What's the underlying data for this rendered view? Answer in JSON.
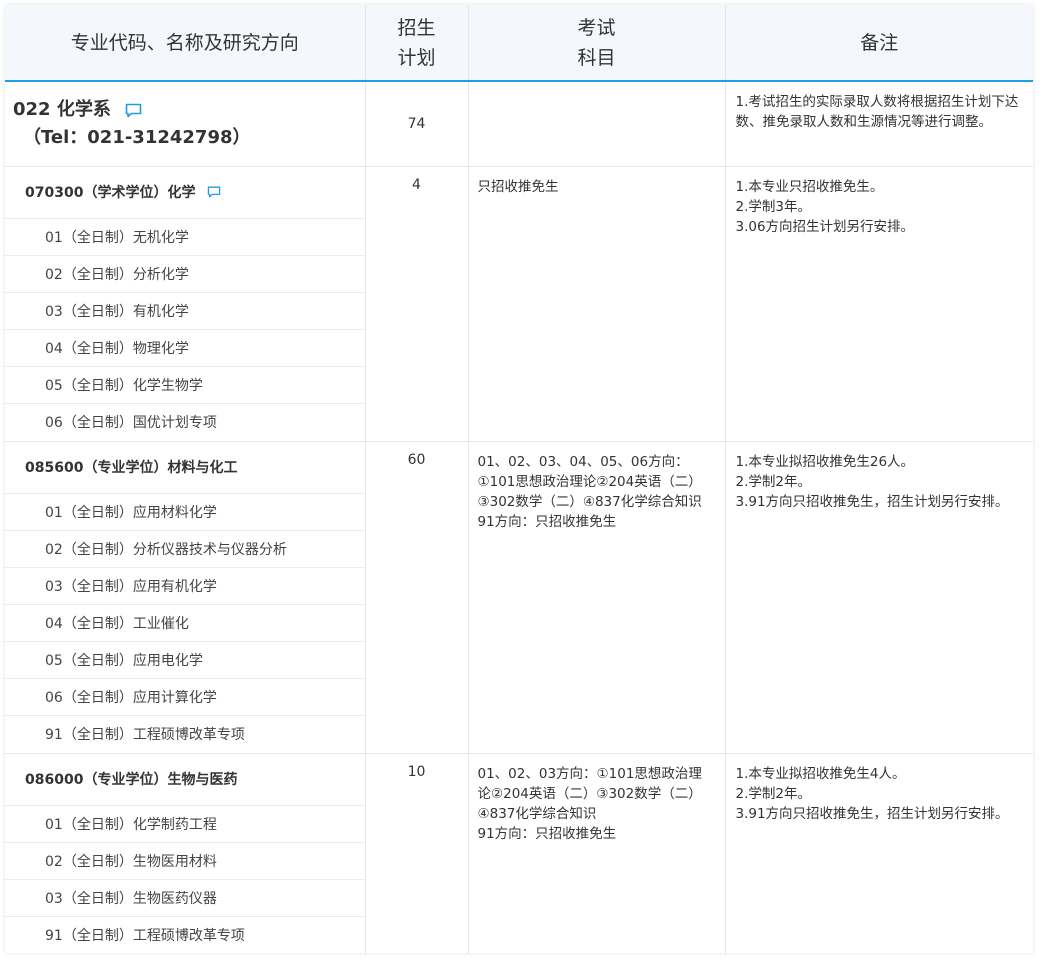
{
  "header": {
    "col_major": "专业代码、名称及研究方向",
    "col_plan_1": "招生",
    "col_plan_2": "计划",
    "col_exam_1": "考试",
    "col_exam_2": "科目",
    "col_note": "备注"
  },
  "dept": {
    "name": "022 化学系",
    "tel": "（Tel：021-31242798）",
    "plan": "74",
    "note": "1.考试招生的实际录取人数将根据招生计划下达数、推免录取人数和生源情况等进行调整。"
  },
  "majors": [
    {
      "title": "070300（学术学位）化学",
      "plan": "4",
      "exam": [
        "只招收推免生"
      ],
      "notes": [
        "1.本专业只招收推免生。",
        "2.学制3年。",
        "3.06方向招生计划另行安排。"
      ],
      "directions": [
        "01（全日制）无机化学",
        "02（全日制）分析化学",
        "03（全日制）有机化学",
        "04（全日制）物理化学",
        "05（全日制）化学生物学",
        "06（全日制）国优计划专项"
      ]
    },
    {
      "title": "085600（专业学位）材料与化工",
      "plan": "60",
      "exam": [
        "01、02、03、04、05、06方向：",
        "①101思想政治理论②204英语（二）",
        "③302数学（二）④837化学综合知识",
        "91方向：只招收推免生"
      ],
      "notes": [
        "1.本专业拟招收推免生26人。",
        "2.学制2年。",
        "3.91方向只招收推免生，招生计划另行安排。"
      ],
      "directions": [
        "01（全日制）应用材料化学",
        "02（全日制）分析仪器技术与仪器分析",
        "03（全日制）应用有机化学",
        "04（全日制）工业催化",
        "05（全日制）应用电化学",
        "06（全日制）应用计算化学",
        "91（全日制）工程硕博改革专项"
      ]
    },
    {
      "title": "086000（专业学位）生物与医药",
      "plan": "10",
      "exam": [
        "01、02、03方向：①101思想政治理",
        "论②204英语（二）③302数学（二）",
        "④837化学综合知识",
        "91方向：只招收推免生"
      ],
      "notes": [
        "1.本专业拟招收推免生4人。",
        "2.学制2年。",
        "3.91方向只招收推免生，招生计划另行安排。"
      ],
      "directions": [
        "01（全日制）化学制药工程",
        "02（全日制）生物医用材料",
        "03（全日制）生物医药仪器",
        "91（全日制）工程硕博改革专项"
      ]
    }
  ],
  "colors": {
    "accent": "#1e9ce6",
    "header_bg": "#f4f7fc",
    "border": "#e3e8ee"
  }
}
